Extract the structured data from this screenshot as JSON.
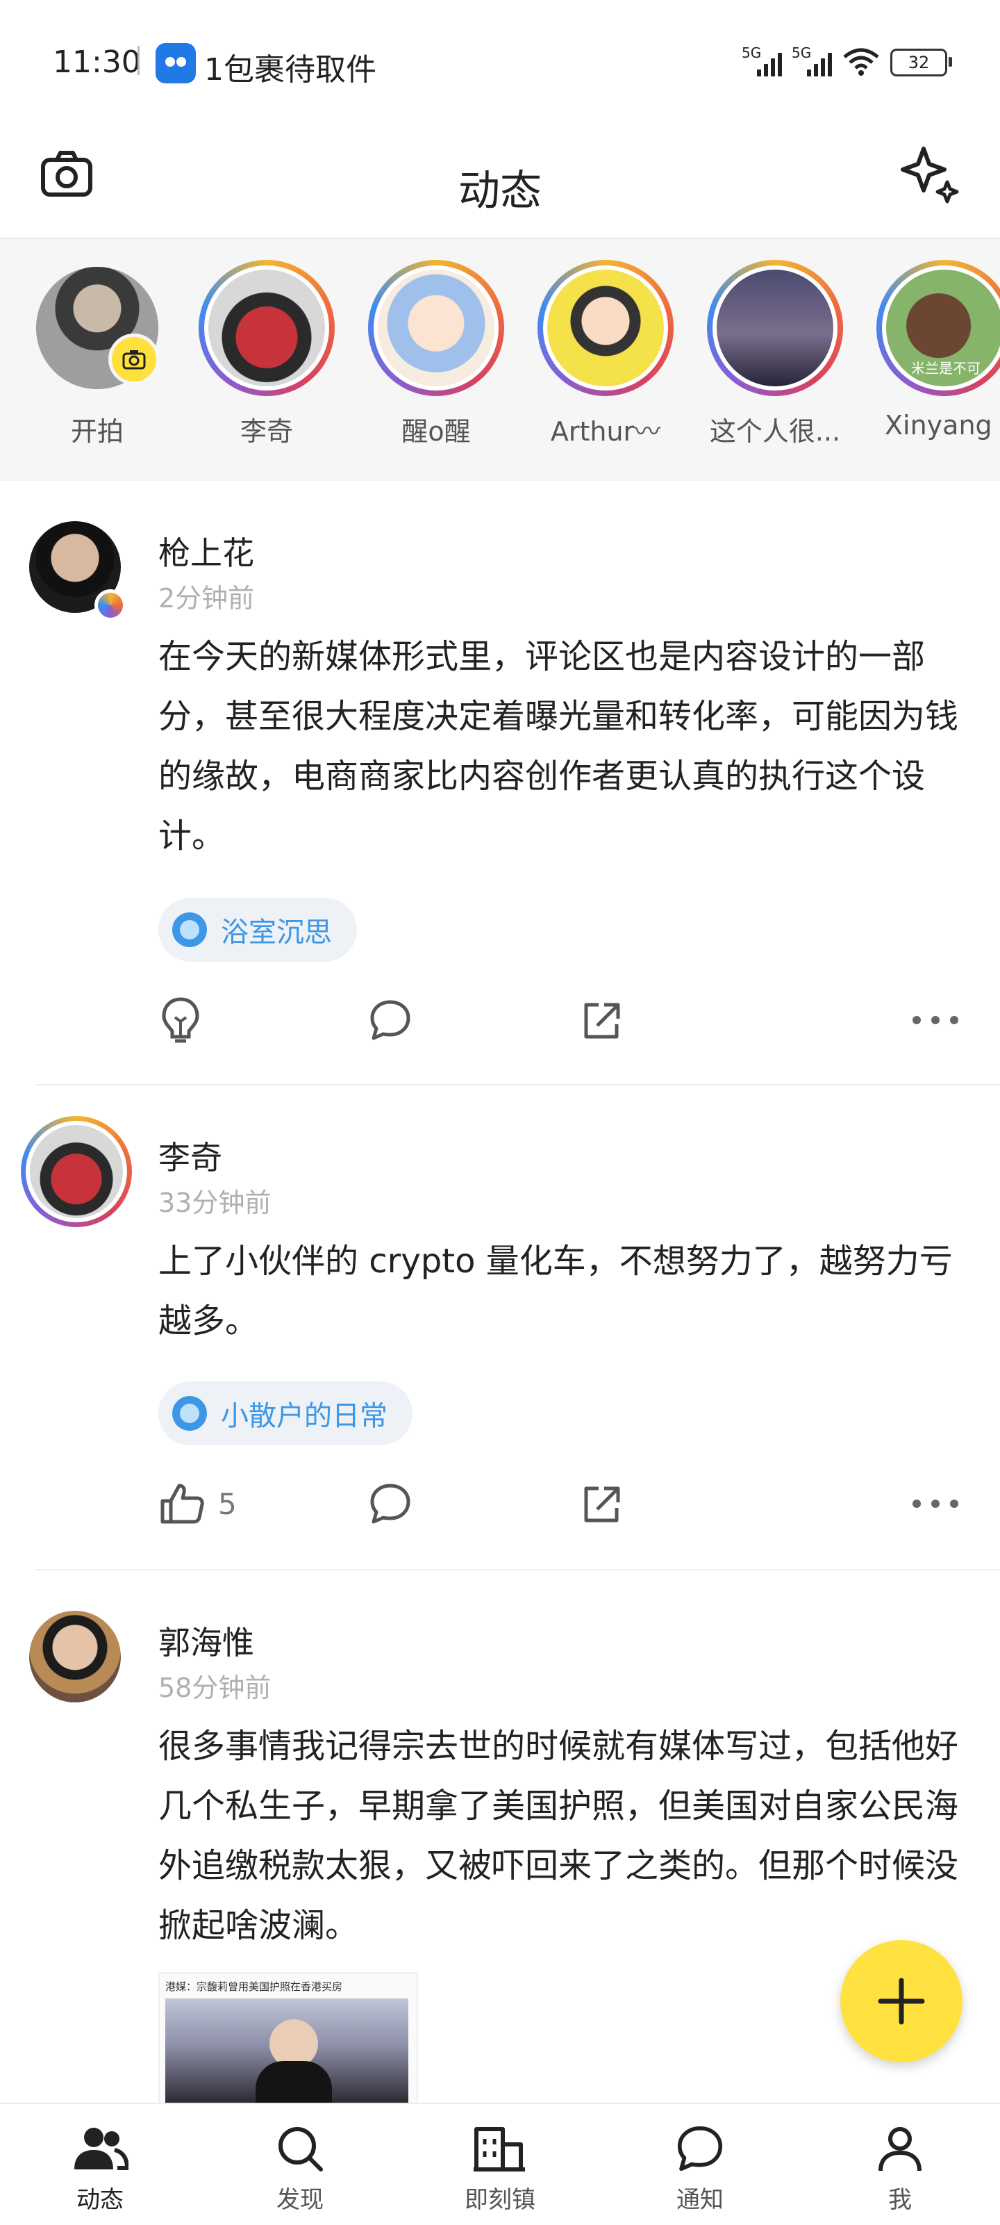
{
  "status_bar": {
    "time": "11:30",
    "notification": "1包裹待取件",
    "signal1": "5G",
    "signal2": "5G",
    "wifi_label": "6",
    "battery": "32"
  },
  "header": {
    "title": "动态"
  },
  "stories": [
    {
      "label": "开拍"
    },
    {
      "label": "李奇"
    },
    {
      "label": "醒o醒"
    },
    {
      "label": "Arthur〰"
    },
    {
      "label": "这个人很..."
    },
    {
      "label": "Xinyang"
    }
  ],
  "story_overlay_text": "米兰是不可",
  "posts": [
    {
      "author": "枪上花",
      "time": "2分钟前",
      "content": "在今天的新媒体形式里，评论区也是内容设计的一部分，甚至很大程度决定着曝光量和转化率，可能因为钱的缘故，电商商家比内容创作者更认真的执行这个设计。",
      "tag": "浴室沉思"
    },
    {
      "author": "李奇",
      "time": "33分钟前",
      "content": "上了小伙伴的 crypto 量化车，不想努力了，越努力亏越多。",
      "tag": "小散户的日常",
      "likes": "5"
    },
    {
      "author": "郭海惟",
      "time": "58分钟前",
      "content": "很多事情我记得宗去世的时候就有媒体写过，包括他好几个私生子，早期拿了美国护照，但美国对自家公民海外追缴税款太狠，又被吓回来了之类的。但那个时候没掀起啥波澜。",
      "image_caption": "港媒：宗馥莉曾用美国护照在香港买房"
    }
  ],
  "tabs": [
    {
      "label": "动态"
    },
    {
      "label": "发现"
    },
    {
      "label": "即刻镇"
    },
    {
      "label": "通知"
    },
    {
      "label": "我"
    }
  ],
  "colors": {
    "accent": "#ffe23f",
    "topic_blue": "#3e96e6"
  }
}
